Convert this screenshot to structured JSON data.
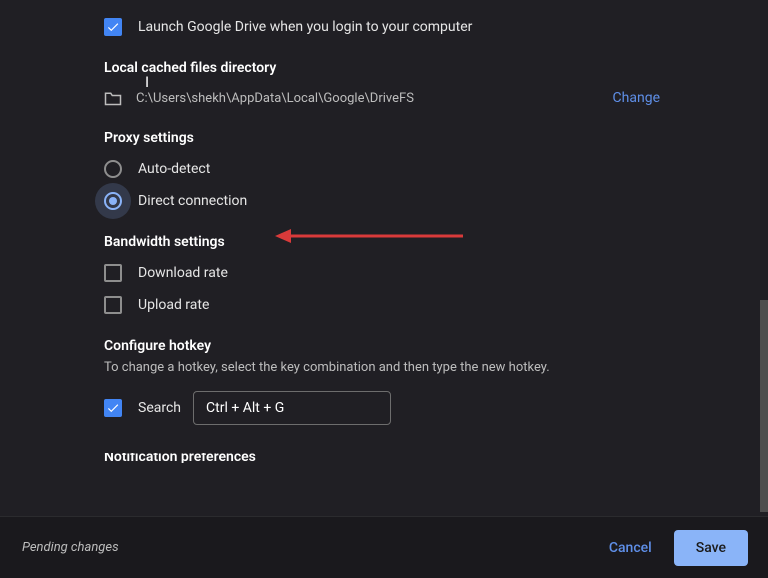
{
  "launch_on_login": {
    "checked": true,
    "label": "Launch Google Drive when you login to your computer"
  },
  "cache": {
    "title": "Local cached files directory",
    "path": "C:\\Users\\shekh\\AppData\\Local\\Google\\DriveFS",
    "change_label": "Change"
  },
  "proxy": {
    "title": "Proxy settings",
    "options": [
      {
        "id": "auto",
        "label": "Auto-detect",
        "selected": false
      },
      {
        "id": "direct",
        "label": "Direct connection",
        "selected": true
      }
    ]
  },
  "bandwidth": {
    "title": "Bandwidth settings",
    "options": [
      {
        "id": "download",
        "label": "Download rate",
        "checked": false
      },
      {
        "id": "upload",
        "label": "Upload rate",
        "checked": false
      }
    ]
  },
  "hotkey": {
    "title": "Configure hotkey",
    "description": "To change a hotkey, select the key combination and then type the new hotkey.",
    "search_label": "Search",
    "search_checked": true,
    "value": "Ctrl + Alt + G"
  },
  "notifications_title": "Notification preferences",
  "footer": {
    "status": "Pending changes",
    "cancel": "Cancel",
    "save": "Save"
  },
  "colors": {
    "accent_blue": "#4285f4",
    "link_blue": "#5f8fe8",
    "annotation_arrow": "#d93a3a"
  }
}
